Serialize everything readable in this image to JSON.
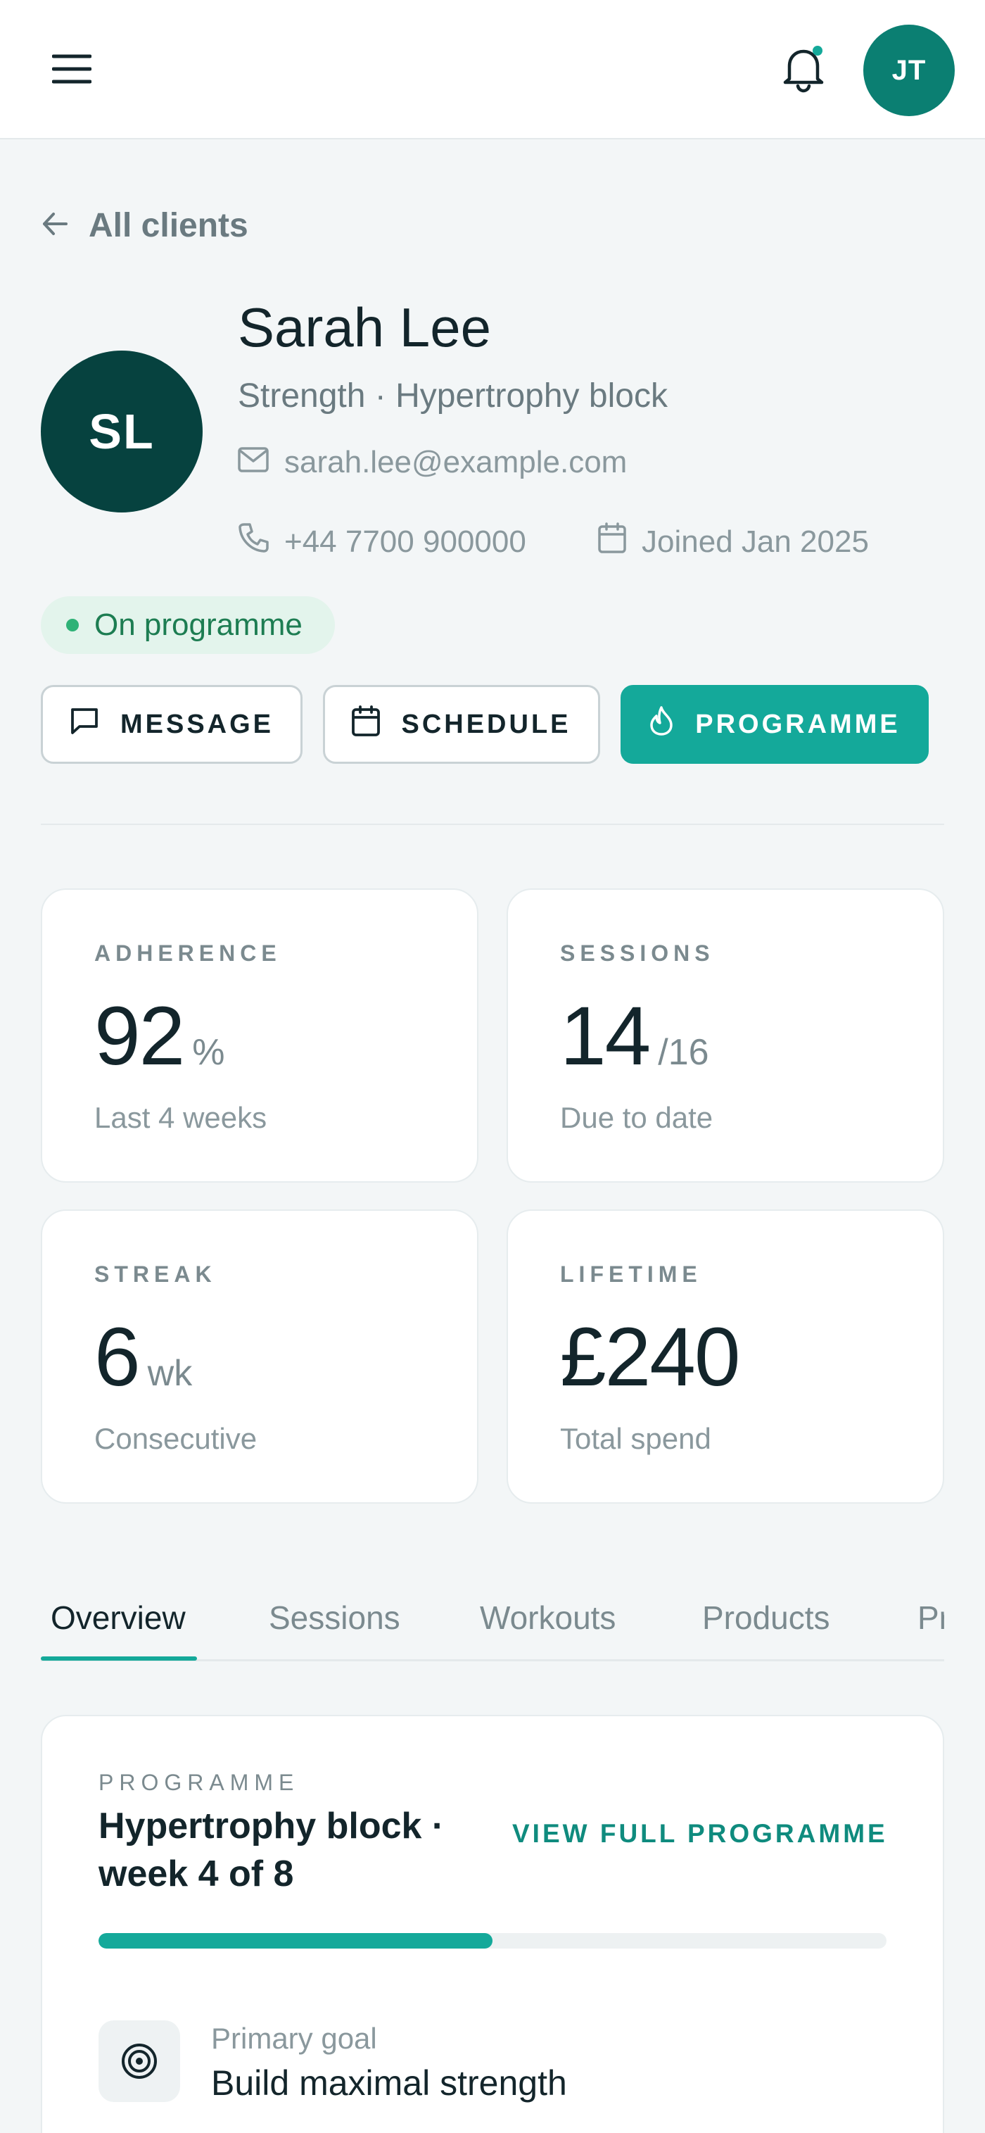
{
  "header": {
    "avatar_initials": "JT",
    "notification_dot_color": "#14a99a",
    "icons": [
      "menu-icon",
      "bell-icon"
    ]
  },
  "back": {
    "label": "All clients"
  },
  "client": {
    "initials": "SL",
    "name": "Sarah Lee",
    "subtitle": "Strength · Hypertrophy block",
    "email": "sarah.lee@example.com",
    "phone": "+44 7700 900000",
    "joined": "Joined Jan 2025",
    "status": "On programme"
  },
  "actions": {
    "message": "MESSAGE",
    "schedule": "SCHEDULE",
    "programme": "PROGRAMME"
  },
  "stats": {
    "adherence": {
      "label": "ADHERENCE",
      "value": "92",
      "unit": "%",
      "caption": "Last 4 weeks"
    },
    "sessions": {
      "label": "SESSIONS",
      "value": "14",
      "unit": "/16",
      "caption": "Due to date"
    },
    "streak": {
      "label": "STREAK",
      "value": "6",
      "unit": "wk",
      "caption": "Consecutive"
    },
    "lifetime": {
      "label": "LIFETIME",
      "value": "£240",
      "unit": "",
      "caption": "Total spend"
    }
  },
  "tabs": [
    {
      "label": "Overview",
      "active": true
    },
    {
      "label": "Sessions",
      "active": false
    },
    {
      "label": "Workouts",
      "active": false
    },
    {
      "label": "Products",
      "active": false
    },
    {
      "label": "Profile",
      "active": false
    }
  ],
  "programme": {
    "kicker": "PROGRAMME",
    "title": "Hypertrophy block · week 4 of 8",
    "link": "VIEW FULL PROGRAMME",
    "progress": 0.5,
    "goal_label": "Primary goal",
    "goal_value": "Build maximal strength"
  },
  "colors": {
    "accent": "#14a99a",
    "accent_dark": "#0b7f72",
    "avatar_dark": "#06423f",
    "status_green": "#2fb277",
    "background": "#f3f6f7"
  }
}
